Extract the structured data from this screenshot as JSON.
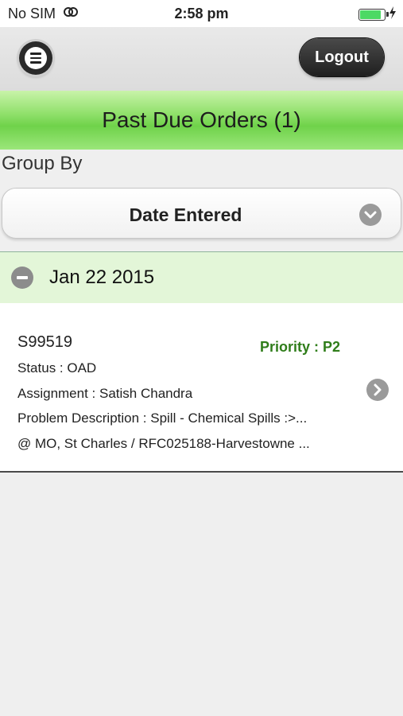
{
  "status_bar": {
    "carrier": "No SIM",
    "time": "2:58 pm"
  },
  "header": {
    "logout_label": "Logout"
  },
  "page": {
    "title": "Past Due Orders (1)"
  },
  "group_by": {
    "label": "Group By",
    "selected": "Date Entered"
  },
  "groups": [
    {
      "date": "Jan 22 2015",
      "orders": [
        {
          "id": "S99519",
          "priority": "Priority : P2",
          "status": "Status : OAD",
          "assignment": "Assignment : Satish Chandra",
          "problem": "Problem Description : Spill - Chemical Spills :>...",
          "location": "@ MO, St Charles / RFC025188-Harvestowne ..."
        }
      ]
    }
  ],
  "colors": {
    "title_green": "#6fd24a",
    "priority_green": "#2f7d1a",
    "group_bg": "#e3f6d8"
  }
}
